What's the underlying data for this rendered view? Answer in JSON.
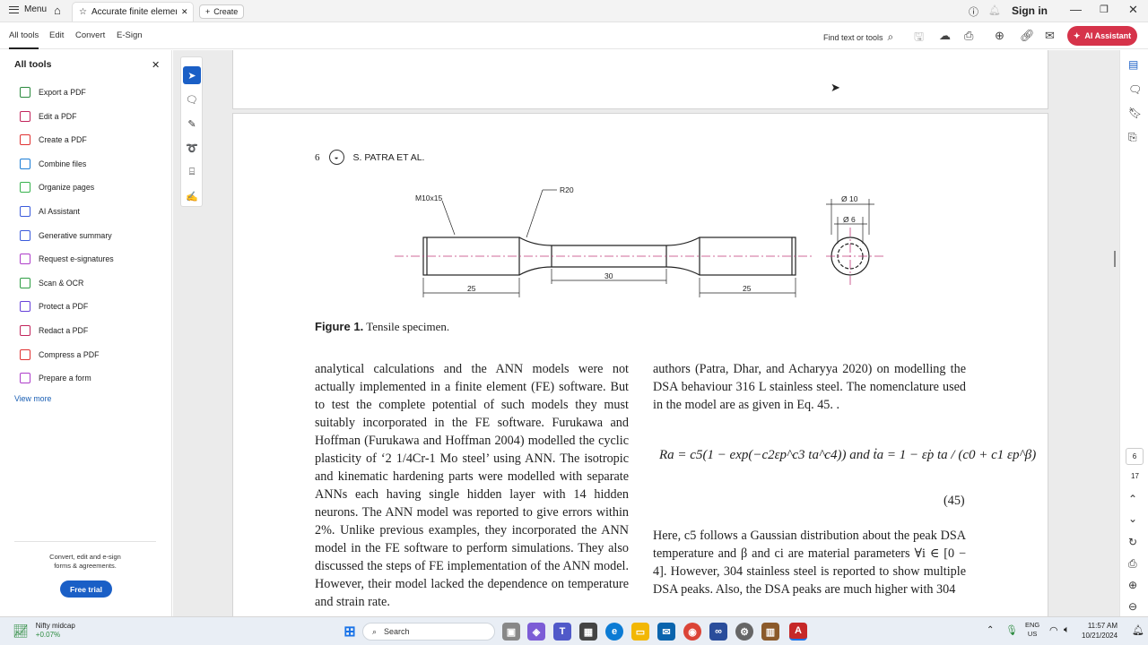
{
  "titlebar": {
    "menu_label": "Menu",
    "tab_title": "Accurate finite element ...",
    "create_label": "Create",
    "sign_in": "Sign in"
  },
  "toolbar": {
    "all_tools": "All tools",
    "edit": "Edit",
    "convert": "Convert",
    "esign": "E-Sign",
    "find_text": "Find text or tools",
    "ai_assistant": "AI Assistant"
  },
  "sidebar": {
    "title": "All tools",
    "items": [
      {
        "label": "Export a PDF",
        "color": "#2b8a3e"
      },
      {
        "label": "Edit a PDF",
        "color": "#c2255c"
      },
      {
        "label": "Create a PDF",
        "color": "#e03131"
      },
      {
        "label": "Combine files",
        "color": "#1c7ed6"
      },
      {
        "label": "Organize pages",
        "color": "#37b24d"
      },
      {
        "label": "AI Assistant",
        "color": "#3b5bdb"
      },
      {
        "label": "Generative summary",
        "color": "#3b5bdb"
      },
      {
        "label": "Request e-signatures",
        "color": "#ae3ec9"
      },
      {
        "label": "Scan & OCR",
        "color": "#2f9e44"
      },
      {
        "label": "Protect a PDF",
        "color": "#6741d9"
      },
      {
        "label": "Redact a PDF",
        "color": "#c2255c"
      },
      {
        "label": "Compress a PDF",
        "color": "#e03131"
      },
      {
        "label": "Prepare a form",
        "color": "#ae3ec9"
      }
    ],
    "view_more": "View more",
    "promo_text_1": "Convert, edit and e-sign",
    "promo_text_2": "forms & agreements.",
    "free_trial": "Free trial"
  },
  "document": {
    "running_header": "S. PATRA ET AL.",
    "page_number": "6",
    "figure": {
      "label": "Figure 1.",
      "caption": " Tensile specimen.",
      "thread": "M10x15",
      "radius": "R20",
      "dim_left": "25",
      "dim_mid": "30",
      "dim_right": "25",
      "dia_outer": "Ø 10",
      "dia_inner": "Ø 6"
    },
    "left_column": "analytical calculations and the ANN models were not actually implemented in a finite element (FE) software. But to test the complete potential of such models they must suitably incorporated in the FE software. Furukawa and Hoffman (Furukawa and Hoffman 2004) modelled the cyclic plasticity of ‘2 1/4Cr-1 Mo steel’ using ANN. The isotropic and kinematic hardening parts were modelled with separate ANNs each having single hidden layer with 14 hidden neurons. The ANN model was reported to give errors within 2%. Unlike previous examples, they incorporated the ANN model in the FE software to perform simulations. They also discussed the steps of FE implementation of the ANN model. However, their model lacked the dependence on temperature and strain rate.",
    "right_column_top": "authors (Patra, Dhar, and Acharyya 2020) on modelling the DSA behaviour 316 L stainless steel. The nomenclature used in the model are as given in Eq. 45. .",
    "formula": "Ra = c5(1 − exp(−c2εp^c3 ta^c4)) and ṫa = 1 − ε̇p ta / (c0 + c1 εp^β)",
    "eq_number": "(45)",
    "right_column_bottom": "Here, c5 follows a Gaussian distribution about the peak DSA temperature and β and ci are material parameters ∀i ∈ [0 − 4]. However, 304 stainless steel is reported to show multiple DSA peaks. Also, the DSA peaks are much higher with 304"
  },
  "right_rail": {
    "page_current": "6",
    "page_total": "17"
  },
  "taskbar": {
    "stock_name": "Nifty midcap",
    "stock_change": "+0.07%",
    "search_placeholder": "Search",
    "lang_1": "ENG",
    "lang_2": "US",
    "time": "11:57 AM",
    "date": "10/21/2024"
  }
}
